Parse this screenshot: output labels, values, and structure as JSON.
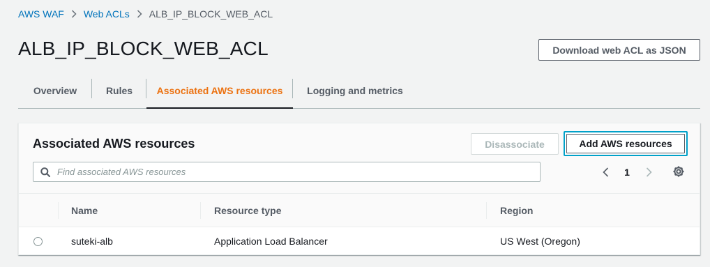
{
  "breadcrumb": {
    "items": [
      "AWS WAF",
      "Web ACLs"
    ],
    "current": "ALB_IP_BLOCK_WEB_ACL"
  },
  "page": {
    "title": "ALB_IP_BLOCK_WEB_ACL",
    "download_label": "Download web ACL as JSON"
  },
  "tabs": [
    {
      "label": "Overview"
    },
    {
      "label": "Rules"
    },
    {
      "label": "Associated AWS resources"
    },
    {
      "label": "Logging and metrics"
    }
  ],
  "panel": {
    "title": "Associated AWS resources",
    "disassociate_label": "Disassociate",
    "add_label": "Add AWS resources",
    "search_placeholder": "Find associated AWS resources",
    "page_number": "1",
    "columns": [
      "Name",
      "Resource type",
      "Region"
    ],
    "rows": [
      {
        "name": "suteki-alb",
        "type": "Application Load Balancer",
        "region": "US West (Oregon)"
      }
    ]
  },
  "icons": {
    "breadcrumb_separator": "chevron-right-icon",
    "search": "search-icon",
    "prev": "chevron-left-icon",
    "next": "chevron-right-icon",
    "settings": "gear-icon"
  },
  "colors": {
    "link": "#0073bb",
    "active_tab": "#ec7211",
    "focus_ring": "#00a1c9"
  }
}
